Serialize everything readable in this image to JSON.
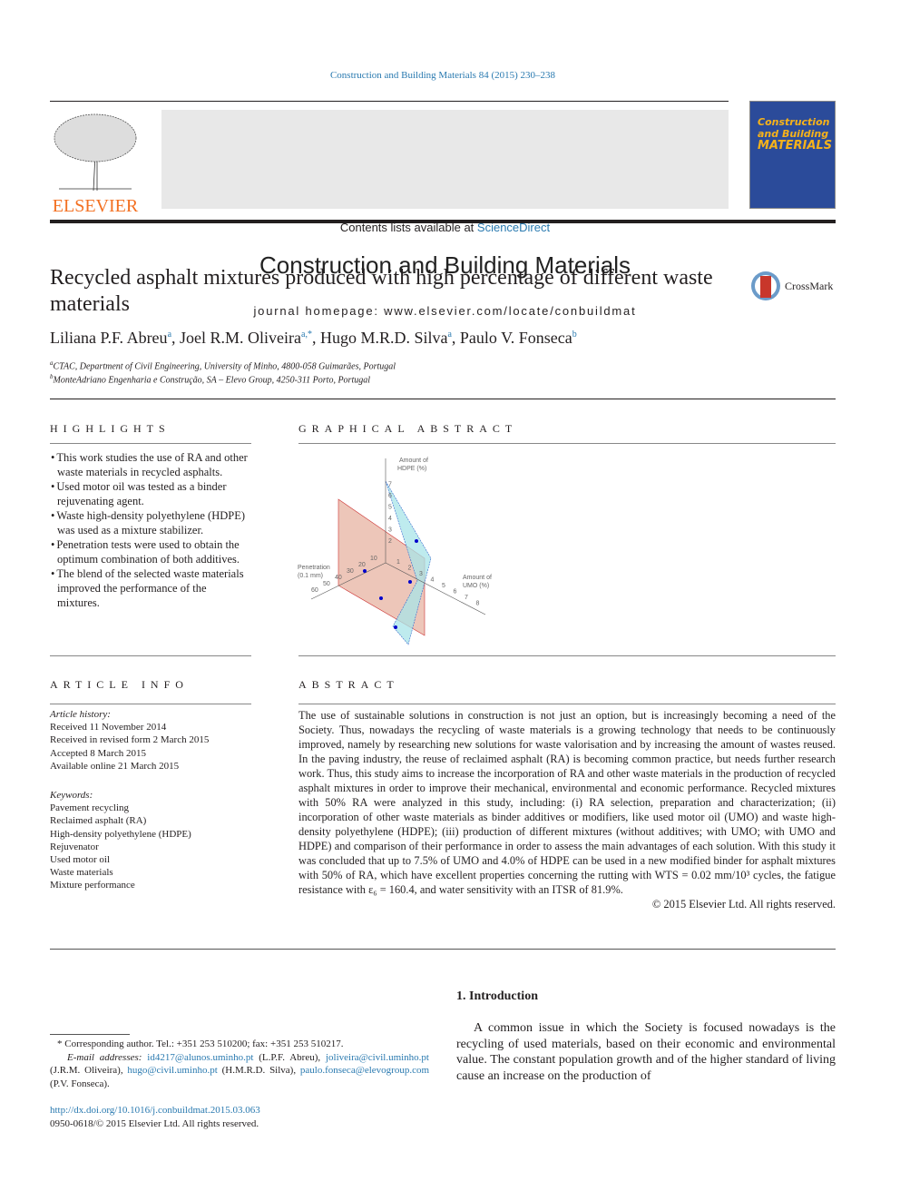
{
  "header": {
    "journal_citation": "Construction and Building Materials 84 (2015) 230–238",
    "contents_prefix": "Contents lists available at ",
    "contents_link": "ScienceDirect",
    "journal_title": "Construction and Building Materials",
    "homepage": "journal homepage: www.elsevier.com/locate/conbuildmat",
    "publisher": "ELSEVIER",
    "cover_title": [
      "Construction",
      "and Building",
      "MATERIALS"
    ]
  },
  "article": {
    "title": "Recycled asphalt mixtures produced with high percentage of different waste materials",
    "crossmark": "CrossMark",
    "authors": [
      {
        "name": "Liliana P.F. Abreu",
        "sup": "a"
      },
      {
        "name": "Joel R.M. Oliveira",
        "sup": "a,*"
      },
      {
        "name": "Hugo M.R.D. Silva",
        "sup": "a"
      },
      {
        "name": "Paulo V. Fonseca",
        "sup": "b"
      }
    ],
    "affiliations": [
      {
        "sup": "a",
        "text": "CTAC, Department of Civil Engineering, University of Minho, 4800-058 Guimarães, Portugal"
      },
      {
        "sup": "b",
        "text": "MonteAdriano Engenharia e Construção, SA – Elevo Group, 4250-311 Porto, Portugal"
      }
    ]
  },
  "highlights": {
    "heading": "Highlights",
    "items": [
      "This work studies the use of RA and other waste materials in recycled asphalts.",
      "Used motor oil was tested as a binder rejuvenating agent.",
      "Waste high-density polyethylene (HDPE) was used as a mixture stabilizer.",
      "Penetration tests were used to obtain the optimum combination of both additives.",
      "The blend of the selected waste materials improved the performance of the mixtures."
    ]
  },
  "graphical_abstract": {
    "heading": "Graphical abstract",
    "axis_hdpe": [
      "Amount of",
      "HDPE (%)"
    ],
    "axis_umo": [
      "Amount of",
      "UMO (%)"
    ],
    "axis_pen": [
      "Penetration",
      "(0.1 mm)"
    ],
    "hdpe_ticks": [
      "2",
      "3",
      "4",
      "5",
      "6",
      "7"
    ],
    "umo_ticks": [
      "1",
      "2",
      "3",
      "4",
      "5",
      "6",
      "7",
      "8"
    ],
    "pen_ticks": [
      "10",
      "20",
      "30",
      "40",
      "50",
      "60"
    ]
  },
  "article_info": {
    "heading": "Article info",
    "history_label": "Article history:",
    "history": [
      "Received 11 November 2014",
      "Received in revised form 2 March 2015",
      "Accepted 8 March 2015",
      "Available online 21 March 2015"
    ],
    "keywords_label": "Keywords:",
    "keywords": [
      "Pavement recycling",
      "Reclaimed asphalt (RA)",
      "High-density polyethylene (HDPE)",
      "Rejuvenator",
      "Used motor oil",
      "Waste materials",
      "Mixture performance"
    ]
  },
  "abstract": {
    "heading": "Abstract",
    "text": "The use of sustainable solutions in construction is not just an option, but is increasingly becoming a need of the Society. Thus, nowadays the recycling of waste materials is a growing technology that needs to be continuously improved, namely by researching new solutions for waste valorisation and by increasing the amount of wastes reused. In the paving industry, the reuse of reclaimed asphalt (RA) is becoming common practice, but needs further research work. Thus, this study aims to increase the incorporation of RA and other waste materials in the production of recycled asphalt mixtures in order to improve their mechanical, environmental and economic performance. Recycled mixtures with 50% RA were analyzed in this study, including: (i) RA selection, preparation and characterization; (ii) incorporation of other waste materials as binder additives or modifiers, like used motor oil (UMO) and waste high-density polyethylene (HDPE); (iii) production of different mixtures (without additives; with UMO; with UMO and HDPE) and comparison of their performance in order to assess the main advantages of each solution. With this study it was concluded that up to 7.5% of UMO and 4.0% of HDPE can be used in a new modified binder for asphalt mixtures with 50% of RA, which have excellent properties concerning the rutting with WTS = 0.02 mm/10³ cycles, the fatigue resistance with ε₆ = 160.4, and water sensitivity with an ITSR of 81.9%.",
    "copyright": "© 2015 Elsevier Ltd. All rights reserved."
  },
  "introduction": {
    "heading": "1. Introduction",
    "text": "A common issue in which the Society is focused nowadays is the recycling of used materials, based on their economic and environmental value. The constant population growth and of the higher standard of living cause an increase on the production of"
  },
  "footnotes": {
    "corresponding": "Corresponding author. Tel.: +351 253 510200; fax: +351 253 510217.",
    "email_label": "E-mail addresses:",
    "emails": [
      {
        "email": "id4217@alunos.uminho.pt",
        "who": " (L.P.F. Abreu), "
      },
      {
        "email": "joliveira@civil.uminho.pt",
        "who": " (J.R.M. Oliveira), "
      },
      {
        "email": "hugo@civil.uminho.pt",
        "who": " (H.M.R.D. Silva), "
      },
      {
        "email": "paulo.fonseca@elevogroup.com",
        "who": " (P.V. Fonseca)."
      }
    ],
    "doi": "http://dx.doi.org/10.1016/j.conbuildmat.2015.03.063",
    "issn": "0950-0618/© 2015 Elsevier Ltd. All rights reserved."
  },
  "colors": {
    "link": "#2a7ab0",
    "elsevier_orange": "#f37021",
    "cover_blue": "#2b4b9a"
  }
}
